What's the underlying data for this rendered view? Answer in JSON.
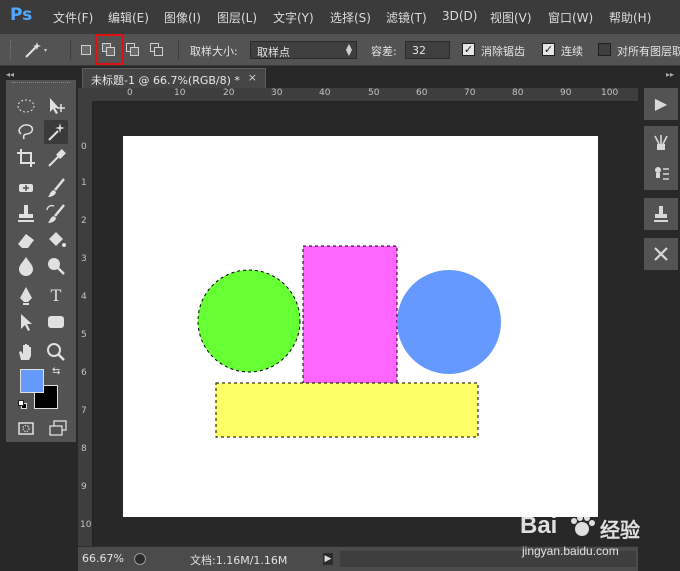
{
  "app": {
    "logo": "Ps"
  },
  "menu": [
    "文件(F)",
    "编辑(E)",
    "图像(I)",
    "图层(L)",
    "文字(Y)",
    "选择(S)",
    "滤镜(T)",
    "3D(D)",
    "视图(V)",
    "窗口(W)",
    "帮助(H)"
  ],
  "options": {
    "sample_size_label": "取样大小:",
    "sample_size_value": "取样点",
    "tolerance_label": "容差:",
    "tolerance_value": "32",
    "antialias_label": "消除锯齿",
    "antialias_checked": true,
    "contiguous_label": "连续",
    "contiguous_checked": true,
    "all_layers_label": "对所有图层取",
    "all_layers_checked": false,
    "selection_mode_active": "add-to-selection"
  },
  "document": {
    "tab_title": "未标题-1 @ 66.7%(RGB/8) *",
    "close_glyph": "×"
  },
  "ruler": {
    "top_labels": [
      "0",
      "10",
      "20",
      "30",
      "40",
      "50",
      "60",
      "70",
      "80",
      "90",
      "100"
    ],
    "left_labels": [
      "0",
      "1",
      "2",
      "3",
      "4",
      "5",
      "6",
      "7",
      "8",
      "9",
      "10"
    ]
  },
  "shapes": {
    "green_circle": {
      "color": "#66ff33",
      "selected": true
    },
    "magenta_rect": {
      "color": "#ff66ff",
      "selected": true
    },
    "blue_circle": {
      "color": "#6699ff",
      "selected": false
    },
    "yellow_rect": {
      "color": "#ffff66",
      "selected": true
    }
  },
  "status": {
    "zoom": "66.67%",
    "doc_info": "文档:1.16M/1.16M"
  },
  "swatches": {
    "foreground": "#6699ff",
    "background": "#000000"
  },
  "watermark": {
    "brand": "Bai",
    "brand2": "经验",
    "url": "jingyan.baidu.com"
  }
}
